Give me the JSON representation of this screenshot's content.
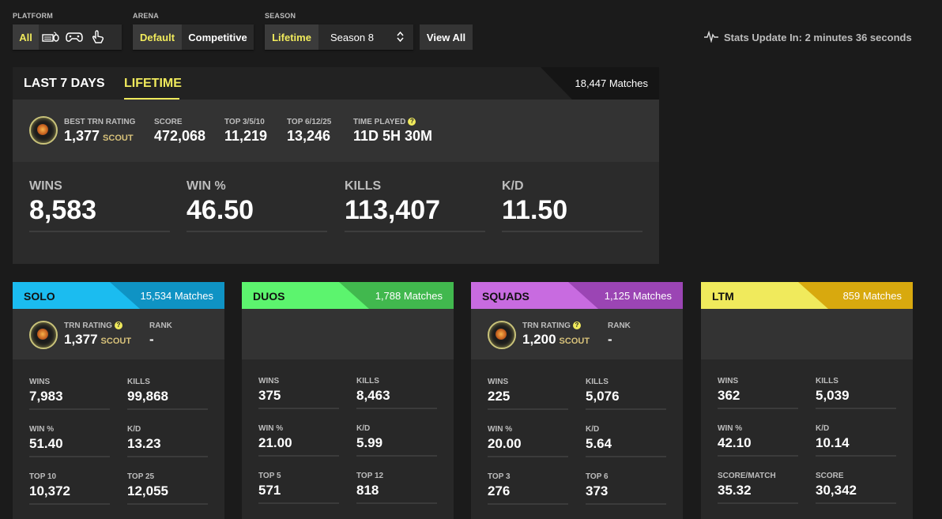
{
  "filters": {
    "platform": {
      "label": "PLATFORM",
      "all": "All"
    },
    "arena": {
      "label": "ARENA",
      "default": "Default",
      "competitive": "Competitive"
    },
    "season": {
      "label": "SEASON",
      "lifetime": "Lifetime",
      "selected": "Season 8"
    },
    "view_all": "View All"
  },
  "update_text": "Stats Update In: 2 minutes 36 seconds",
  "lifetime": {
    "tabs": [
      "LAST 7 DAYS",
      "LIFETIME"
    ],
    "matches": "18,447 Matches",
    "best_trn_label": "BEST TRN RATING",
    "best_trn_value": "1,377",
    "best_trn_rank": "SCOUT",
    "score_label": "SCORE",
    "score_value": "472,068",
    "top3_label": "TOP 3/5/10",
    "top3_value": "11,219",
    "top6_label": "TOP 6/12/25",
    "top6_value": "13,246",
    "time_label": "TIME PLAYED",
    "time_value": "11D 5H 30M",
    "wins_label": "WINS",
    "wins_value": "8,583",
    "winp_label": "WIN %",
    "winp_value": "46.50",
    "kills_label": "KILLS",
    "kills_value": "113,407",
    "kd_label": "K/D",
    "kd_value": "11.50"
  },
  "colors": {
    "accent": "#f0ea5c",
    "solo": "#1bbcf0",
    "duos": "#5cf46e",
    "squads": "#c86be0",
    "ltm": "#f0ea5c"
  },
  "cards": {
    "solo": {
      "name": "SOLO",
      "matches": "15,534 Matches",
      "trn_label": "TRN RATING",
      "trn_value": "1,377",
      "trn_rank": "SCOUT",
      "rank_label": "RANK",
      "rank_value": "-",
      "stats": [
        {
          "label": "WINS",
          "value": "7,983"
        },
        {
          "label": "KILLS",
          "value": "99,868"
        },
        {
          "label": "WIN %",
          "value": "51.40"
        },
        {
          "label": "K/D",
          "value": "13.23"
        },
        {
          "label": "TOP 10",
          "value": "10,372"
        },
        {
          "label": "TOP 25",
          "value": "12,055"
        }
      ]
    },
    "duos": {
      "name": "DUOS",
      "matches": "1,788 Matches",
      "stats": [
        {
          "label": "WINS",
          "value": "375"
        },
        {
          "label": "KILLS",
          "value": "8,463"
        },
        {
          "label": "WIN %",
          "value": "21.00"
        },
        {
          "label": "K/D",
          "value": "5.99"
        },
        {
          "label": "TOP 5",
          "value": "571"
        },
        {
          "label": "TOP 12",
          "value": "818"
        }
      ]
    },
    "squads": {
      "name": "SQUADS",
      "matches": "1,125 Matches",
      "trn_label": "TRN RATING",
      "trn_value": "1,200",
      "trn_rank": "SCOUT",
      "rank_label": "RANK",
      "rank_value": "-",
      "stats": [
        {
          "label": "WINS",
          "value": "225"
        },
        {
          "label": "KILLS",
          "value": "5,076"
        },
        {
          "label": "WIN %",
          "value": "20.00"
        },
        {
          "label": "K/D",
          "value": "5.64"
        },
        {
          "label": "TOP 3",
          "value": "276"
        },
        {
          "label": "TOP 6",
          "value": "373"
        }
      ]
    },
    "ltm": {
      "name": "LTM",
      "matches": "859 Matches",
      "stats": [
        {
          "label": "WINS",
          "value": "362"
        },
        {
          "label": "KILLS",
          "value": "5,039"
        },
        {
          "label": "WIN %",
          "value": "42.10"
        },
        {
          "label": "K/D",
          "value": "10.14"
        },
        {
          "label": "SCORE/MATCH",
          "value": "35.32"
        },
        {
          "label": "SCORE",
          "value": "30,342"
        }
      ]
    }
  }
}
